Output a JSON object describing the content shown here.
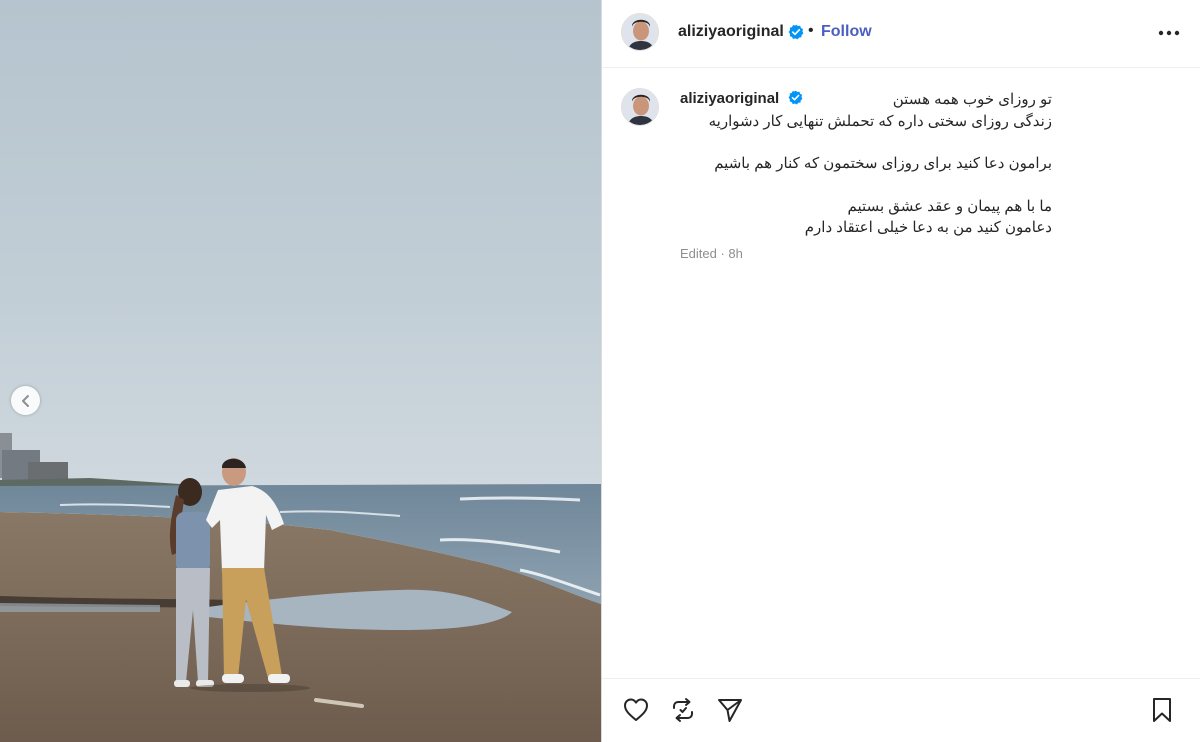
{
  "post": {
    "username": "aliziyaoriginal",
    "verified": true,
    "separator": "•",
    "follow_label": "Follow",
    "more_label": "More options",
    "caption_lines": [
      "تو روزای خوب همه هستن",
      "زندگی روزای سختی داره که تحملش تنهایی کار دشواریه",
      "برامون دعا کنید برای روزای سختمون که کنار هم باشیم",
      "ما با هم پیمان و عقد عشق بستیم",
      "دعامون کنید من به دعا خیلی اعتقاد دارم"
    ],
    "meta": "Edited · 8h"
  },
  "icons": {
    "avatar": "avatar-icon",
    "verified": "verified-badge-icon",
    "more": "more-options-icon",
    "prev": "chevron-left-icon",
    "like": "heart-icon",
    "repost": "repost-icon",
    "share": "send-icon",
    "save": "bookmark-icon"
  },
  "colors": {
    "follow": "#4a5fc1",
    "verified": "#0095f6",
    "text": "#262626",
    "muted": "#8e8e8e",
    "sky": "#b9c8d3",
    "sea": "#7d93a6",
    "sand": "#7c6a58"
  }
}
